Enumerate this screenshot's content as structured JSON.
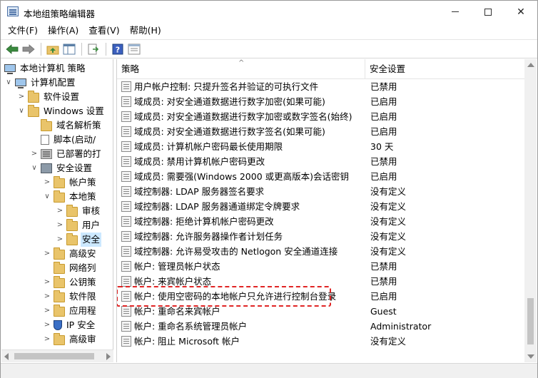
{
  "window": {
    "title": "本地组策略编辑器"
  },
  "menu": [
    "文件(F)",
    "操作(A)",
    "查看(V)",
    "帮助(H)"
  ],
  "tree": [
    {
      "label": "本地计算机 策略",
      "icon": "computer-icon",
      "expanded": true
    },
    {
      "label": "计算机配置",
      "icon": "computer-icon",
      "expanded": true
    },
    {
      "label": "软件设置",
      "icon": "folder-icon",
      "expanded": false
    },
    {
      "label": "Windows 设置",
      "icon": "folder-icon",
      "expanded": true
    },
    {
      "label": "域名解析策",
      "icon": "folder-icon",
      "expanded": null
    },
    {
      "label": "脚本(启动/",
      "icon": "document-icon",
      "expanded": null
    },
    {
      "label": "已部署的打",
      "icon": "printer-icon",
      "expanded": false
    },
    {
      "label": "安全设置",
      "icon": "lock-icon",
      "expanded": true
    },
    {
      "label": "帐户策",
      "icon": "folder-lock-icon",
      "expanded": false
    },
    {
      "label": "本地策",
      "icon": "folder-lock-icon",
      "expanded": true
    },
    {
      "label": "审核",
      "icon": "folder-lock-icon",
      "expanded": false
    },
    {
      "label": "用户",
      "icon": "folder-lock-icon",
      "expanded": false
    },
    {
      "label": "安全",
      "icon": "folder-lock-icon",
      "expanded": false,
      "selected": true
    },
    {
      "label": "高级安",
      "icon": "folder-lock-icon",
      "expanded": false
    },
    {
      "label": "网络列",
      "icon": "folder-icon",
      "expanded": null
    },
    {
      "label": "公钥策",
      "icon": "folder-icon",
      "expanded": false
    },
    {
      "label": "软件限",
      "icon": "folder-icon",
      "expanded": false
    },
    {
      "label": "应用程",
      "icon": "folder-icon",
      "expanded": false
    },
    {
      "label": "IP 安全",
      "icon": "shield-icon",
      "expanded": false
    },
    {
      "label": "高级审",
      "icon": "folder-icon",
      "expanded": false
    }
  ],
  "columns": {
    "policy": "策略",
    "setting": "安全设置"
  },
  "policies": [
    {
      "name": "用户帐户控制: 只提升签名并验证的可执行文件",
      "setting": "已禁用"
    },
    {
      "name": "域成员: 对安全通道数据进行数字加密(如果可能)",
      "setting": "已启用"
    },
    {
      "name": "域成员: 对安全通道数据进行数字加密或数字签名(始终)",
      "setting": "已启用"
    },
    {
      "name": "域成员: 对安全通道数据进行数字签名(如果可能)",
      "setting": "已启用"
    },
    {
      "name": "域成员: 计算机帐户密码最长使用期限",
      "setting": "30 天"
    },
    {
      "name": "域成员: 禁用计算机帐户密码更改",
      "setting": "已禁用"
    },
    {
      "name": "域成员: 需要强(Windows 2000 或更高版本)会话密钥",
      "setting": "已启用"
    },
    {
      "name": "域控制器: LDAP 服务器签名要求",
      "setting": "没有定义"
    },
    {
      "name": "域控制器: LDAP 服务器通道绑定令牌要求",
      "setting": "没有定义"
    },
    {
      "name": "域控制器: 拒绝计算机帐户密码更改",
      "setting": "没有定义"
    },
    {
      "name": "域控制器: 允许服务器操作者计划任务",
      "setting": "没有定义"
    },
    {
      "name": "域控制器:  允许易受攻击的 Netlogon 安全通道连接",
      "setting": "没有定义"
    },
    {
      "name": "帐户: 管理员帐户状态",
      "setting": "已禁用"
    },
    {
      "name": "帐户: 来宾帐户状态",
      "setting": "已禁用"
    },
    {
      "name": "帐户: 使用空密码的本地帐户只允许进行控制台登录",
      "setting": "已启用",
      "highlighted": true
    },
    {
      "name": "帐户: 重命名来宾帐户",
      "setting": "Guest"
    },
    {
      "name": "帐户: 重命名系统管理员帐户",
      "setting": "Administrator"
    },
    {
      "name": "帐户: 阻止 Microsoft 帐户",
      "setting": "没有定义"
    }
  ],
  "colors": {
    "selection": "#cce8ff",
    "highlight_border": "#e02424"
  }
}
